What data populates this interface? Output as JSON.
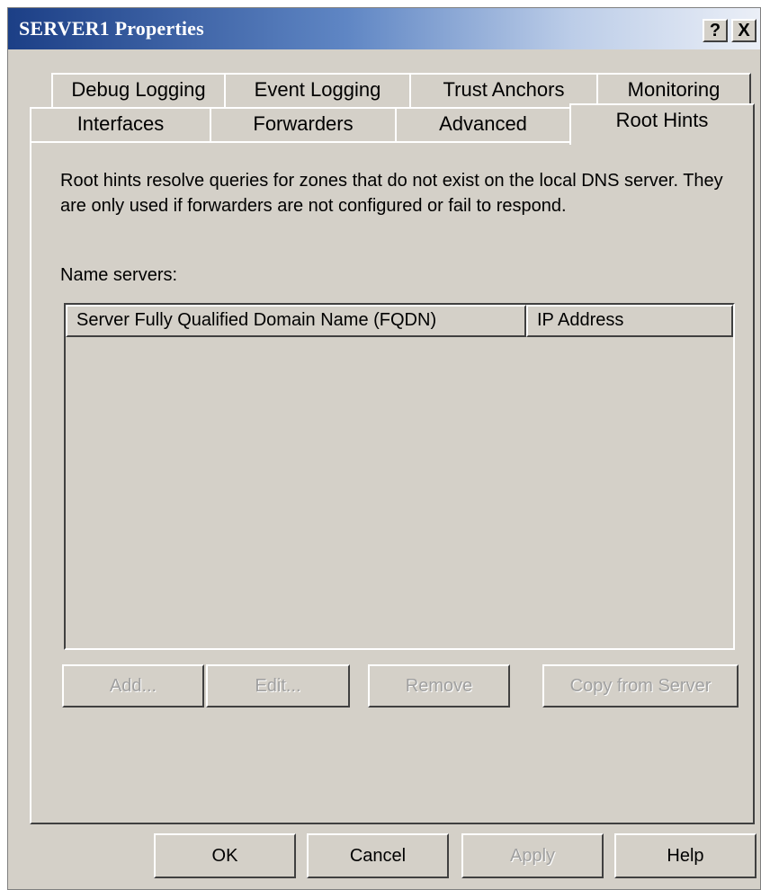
{
  "window": {
    "title": "SERVER1 Properties",
    "help_label": "?",
    "close_label": "X"
  },
  "tabs": {
    "row1": [
      "Debug Logging",
      "Event Logging",
      "Trust Anchors",
      "Monitoring"
    ],
    "row2": [
      "Interfaces",
      "Forwarders",
      "Advanced",
      "Root Hints"
    ],
    "active": "Root Hints"
  },
  "root_hints": {
    "description": "Root hints resolve queries for zones that do not exist on the local DNS server.  They are only used if forwarders are not configured or fail to respond.",
    "name_servers_label": "Name servers:",
    "columns": [
      "Server Fully Qualified Domain Name (FQDN)",
      "IP Address"
    ],
    "rows": [],
    "buttons": {
      "add": "Add...",
      "edit": "Edit...",
      "remove": "Remove",
      "copy": "Copy from Server"
    }
  },
  "footer": {
    "ok": "OK",
    "cancel": "Cancel",
    "apply": "Apply",
    "help": "Help"
  },
  "colors": {
    "dialog_bg": "#d4d0c8",
    "title_start": "#1c3f86",
    "title_end": "#ebeff7"
  }
}
